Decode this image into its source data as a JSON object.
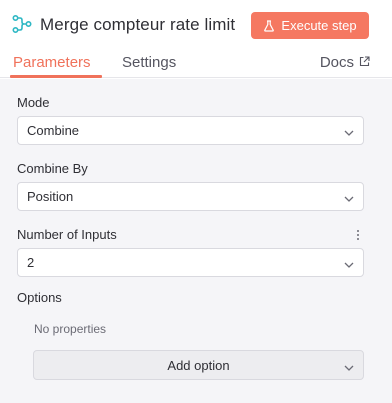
{
  "node": {
    "title": "Merge compteur rate limit",
    "icon": "merge-node-icon",
    "accent_color": "#2fb8c4"
  },
  "toolbar": {
    "execute_label": "Execute step",
    "execute_icon": "flask-icon",
    "execute_color": "#f57861"
  },
  "tabs": {
    "parameters": "Parameters",
    "settings": "Settings",
    "docs": "Docs",
    "active_color": "#f0725b"
  },
  "fields": {
    "mode": {
      "label": "Mode",
      "value": "Combine"
    },
    "combine_by": {
      "label": "Combine By",
      "value": "Position"
    },
    "number_of_inputs": {
      "label": "Number of Inputs",
      "value": "2"
    }
  },
  "options": {
    "label": "Options",
    "empty_text": "No properties",
    "add_label": "Add option"
  }
}
